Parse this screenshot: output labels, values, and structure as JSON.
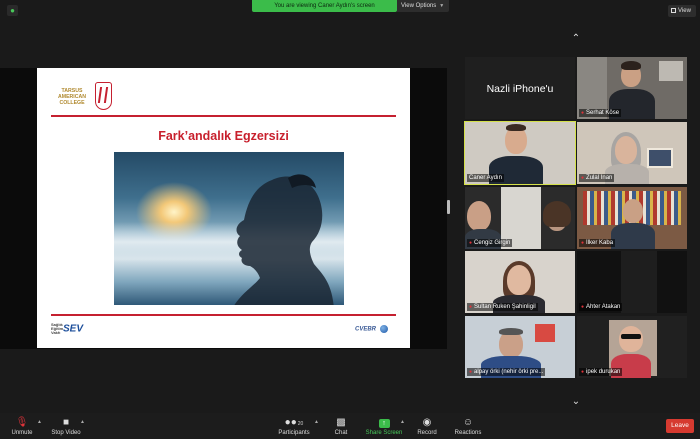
{
  "banner": {
    "text": "You are viewing Caner Aydın's screen",
    "view_options": "View Options"
  },
  "top_right": {
    "view_label": "View"
  },
  "slide": {
    "logo_tac": "TARSUS AMERICAN COLLEGE",
    "title": "Fark’andalık Egzersizi",
    "logo_sev": "SEV",
    "logo_sev_small": "Sağlık Eğitim Vakfı",
    "logo_cv": "CVEBR"
  },
  "participants": [
    {
      "name": "Nazli iPhone'u",
      "video": false
    },
    {
      "name": "Serhat Köse",
      "video": true,
      "muted": true
    },
    {
      "name": "Caner Aydın",
      "video": true,
      "muted": false,
      "active": true
    },
    {
      "name": "Zulal Inan",
      "video": true,
      "muted": true
    },
    {
      "name": "Cengiz Girgin",
      "video": true,
      "muted": true
    },
    {
      "name": "İlker Kaba",
      "video": true,
      "muted": true
    },
    {
      "name": "Sultan Ruken Şahinligil",
      "video": true,
      "muted": true
    },
    {
      "name": "Ahter Atakan",
      "video": false,
      "muted": true
    },
    {
      "name": "alpay örki (nehir örki pre...",
      "video": true,
      "muted": true
    },
    {
      "name": "ipek durukan",
      "video": true,
      "muted": true
    }
  ],
  "toolbar": {
    "unmute": "Unmute",
    "stop_video": "Stop Video",
    "participants": "Participants",
    "participants_count": "20",
    "chat": "Chat",
    "share_screen": "Share Screen",
    "record": "Record",
    "reactions": "Reactions",
    "leave": "Leave"
  }
}
